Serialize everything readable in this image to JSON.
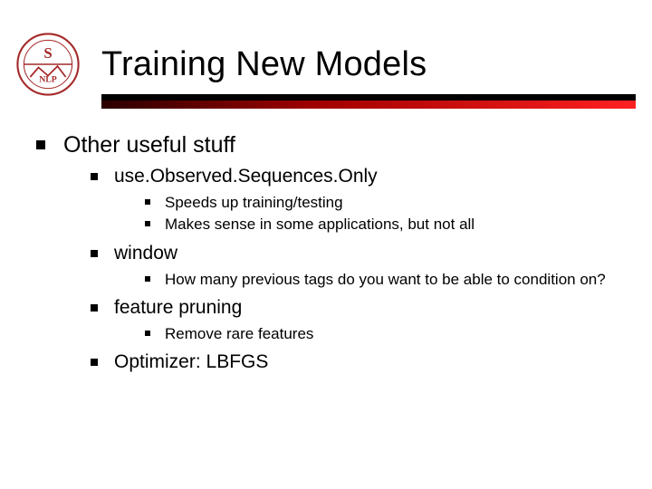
{
  "title": "Training New Models",
  "logo": {
    "top_text": "S",
    "bottom_text": "NLP"
  },
  "bullets": {
    "l1_other": "Other useful stuff",
    "l2_useObserved": "use.Observed.Sequences.Only",
    "l3_speeds": "Speeds up training/testing",
    "l3_makes": "Makes sense in some applications, but not all",
    "l2_window": "window",
    "l3_howmany": "How many previous tags do you want to be able to condition on?",
    "l2_feature": "feature pruning",
    "l3_remove": "Remove rare features",
    "l2_optimizer": "Optimizer: LBFGS"
  }
}
